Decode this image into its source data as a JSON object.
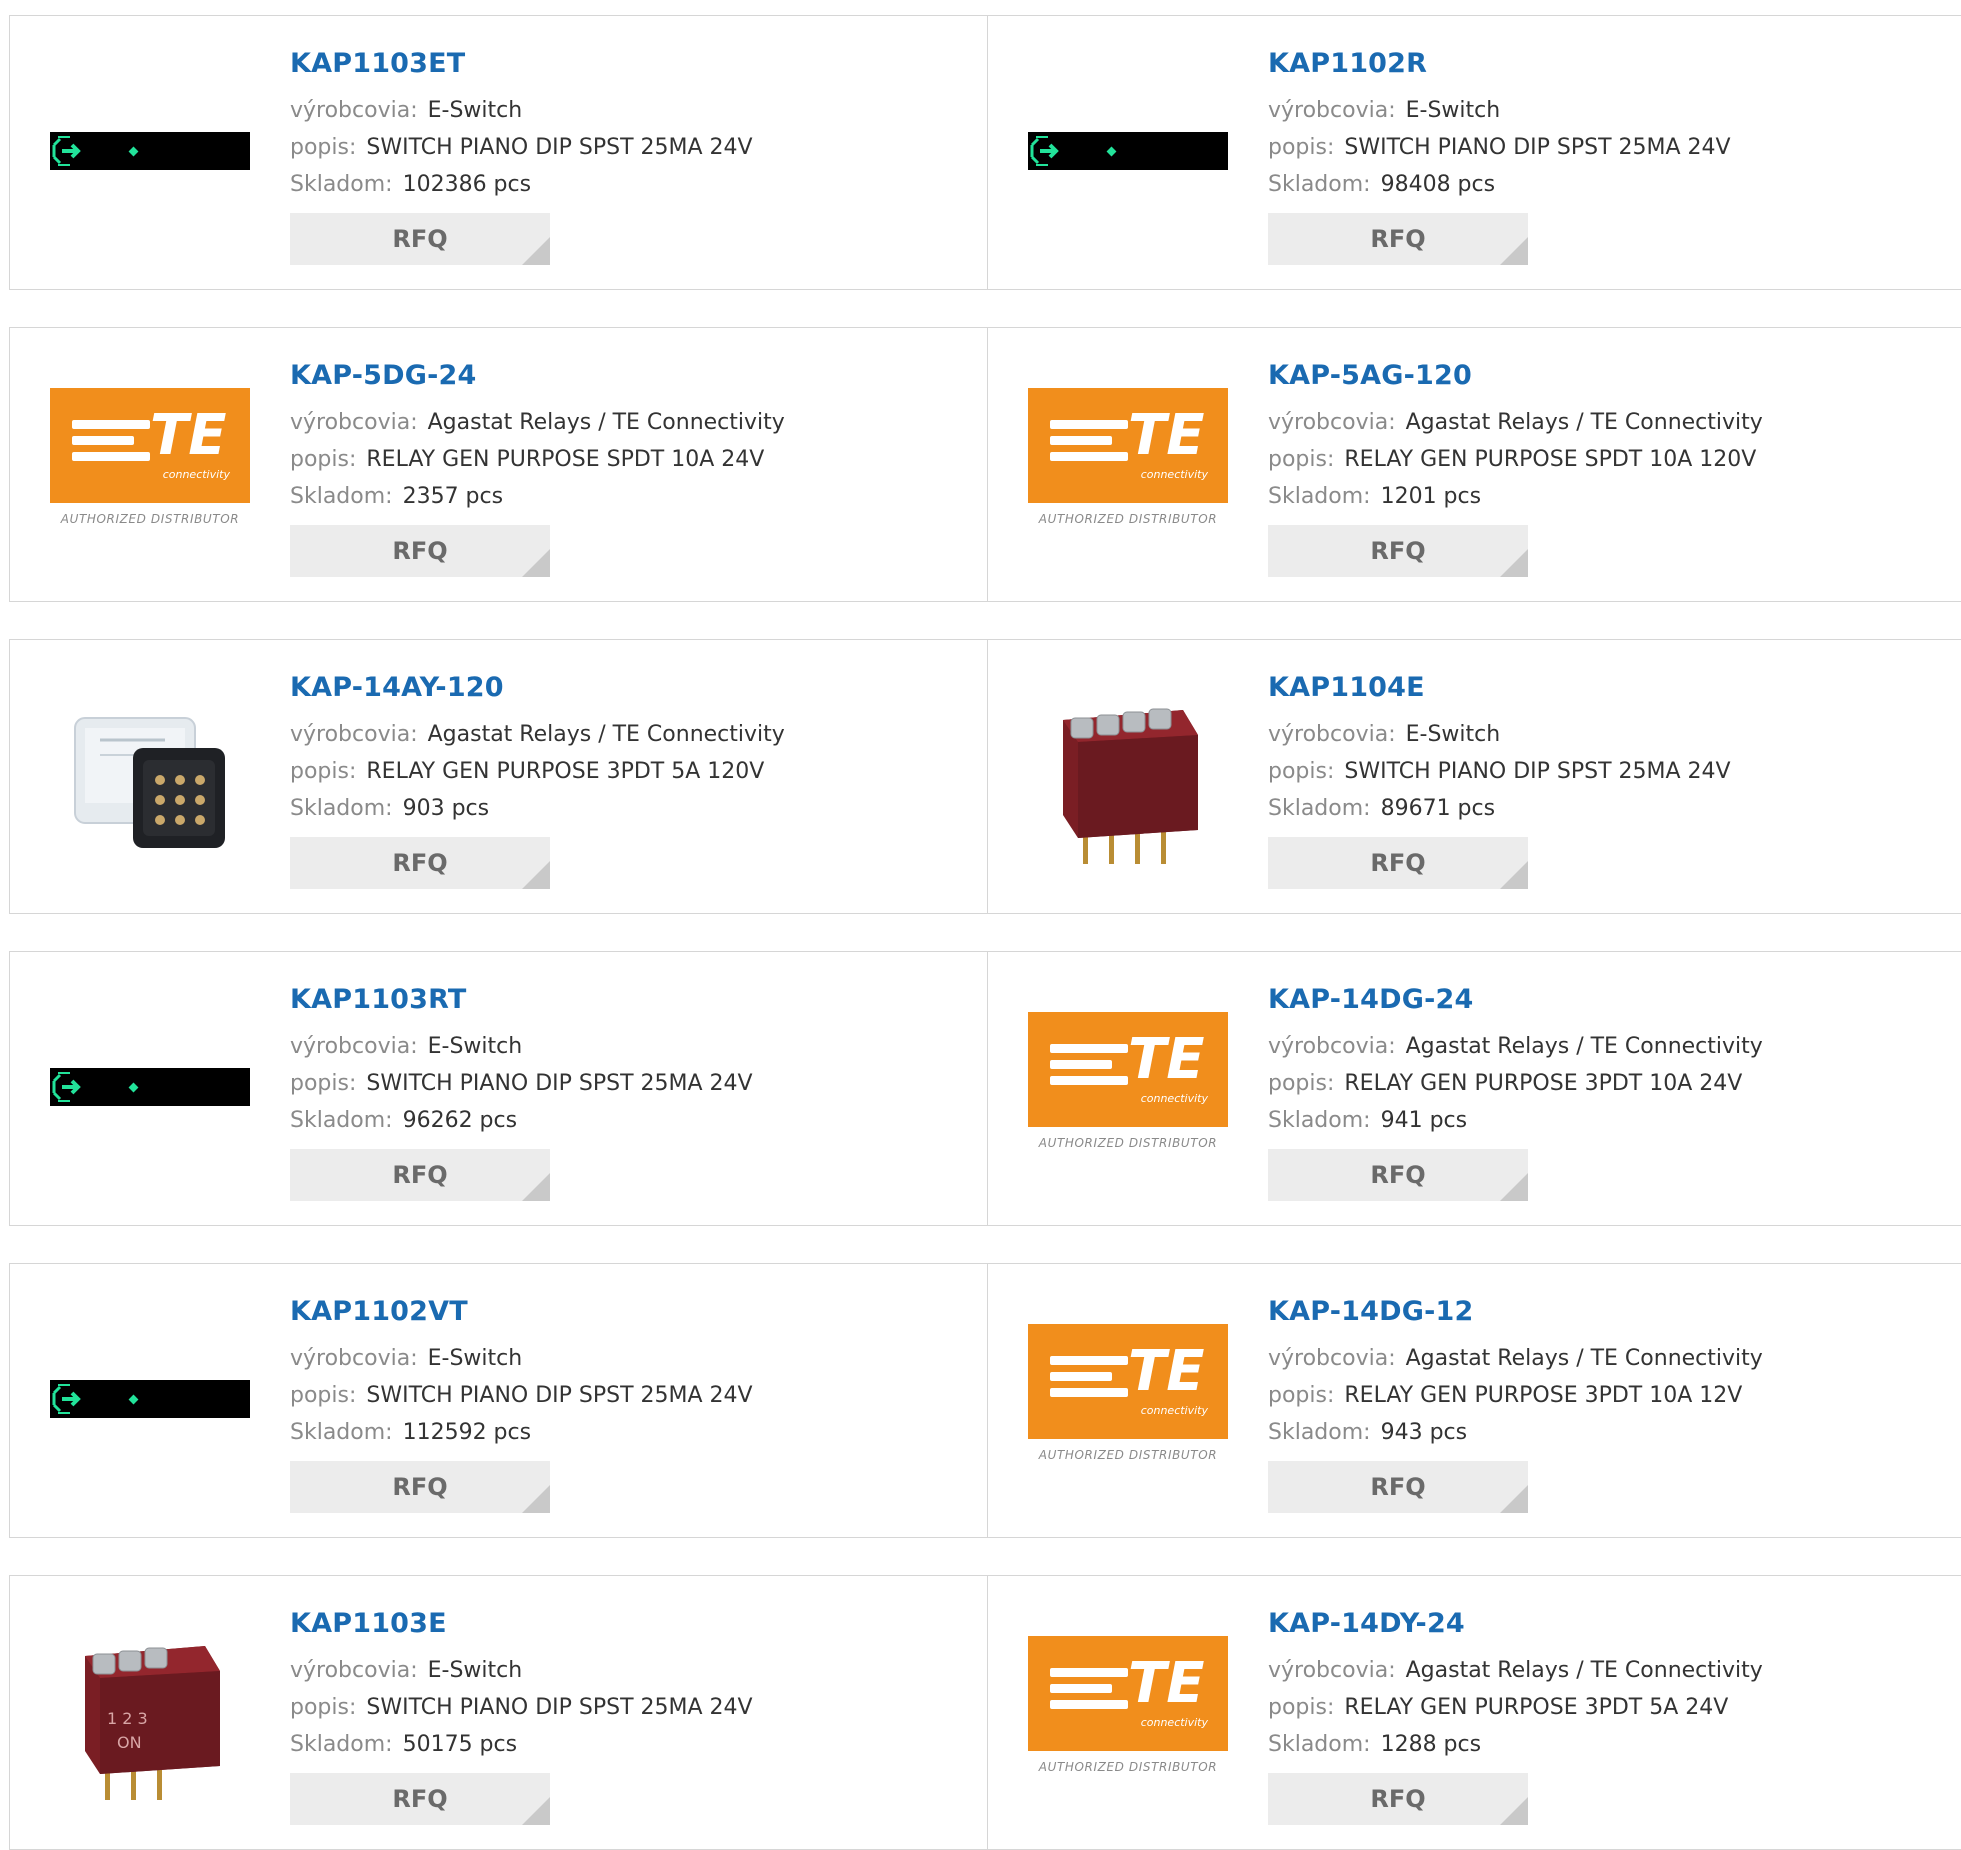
{
  "labels": {
    "manufacturer": "výrobcovia:",
    "description": "popis:",
    "stock": "Skladom:",
    "rfq": "RFQ"
  },
  "colors": {
    "link": "#1a6ab1",
    "label": "#8a8a8a",
    "button_bg": "#ececec",
    "te_orange": "#f18e1c",
    "led_green": "#22e39a"
  },
  "te_logo": {
    "letters": "TE",
    "sub": "connectivity",
    "authorized": "AUTHORIZED DISTRIBUTOR"
  },
  "products": [
    {
      "name": "KAP1103ET",
      "manufacturer": "E-Switch",
      "description": "SWITCH PIANO DIP SPST 25MA 24V",
      "stock": "102386 pcs",
      "image": "led-display"
    },
    {
      "name": "KAP1102R",
      "manufacturer": "E-Switch",
      "description": "SWITCH PIANO DIP SPST 25MA 24V",
      "stock": "98408 pcs",
      "image": "led-display"
    },
    {
      "name": "KAP-5DG-24",
      "manufacturer": "Agastat Relays / TE Connectivity",
      "description": "RELAY GEN PURPOSE SPDT 10A 24V",
      "stock": "2357 pcs",
      "image": "te-logo"
    },
    {
      "name": "KAP-5AG-120",
      "manufacturer": "Agastat Relays / TE Connectivity",
      "description": "RELAY GEN PURPOSE SPDT 10A 120V",
      "stock": "1201 pcs",
      "image": "te-logo"
    },
    {
      "name": "KAP-14AY-120",
      "manufacturer": "Agastat Relays / TE Connectivity",
      "description": "RELAY GEN PURPOSE 3PDT 5A 120V",
      "stock": "903 pcs",
      "image": "relay-photo"
    },
    {
      "name": "KAP1104E",
      "manufacturer": "E-Switch",
      "description": "SWITCH PIANO DIP SPST 25MA 24V",
      "stock": "89671 pcs",
      "image": "dip-switch-4"
    },
    {
      "name": "KAP1103RT",
      "manufacturer": "E-Switch",
      "description": "SWITCH PIANO DIP SPST 25MA 24V",
      "stock": "96262 pcs",
      "image": "led-display"
    },
    {
      "name": "KAP-14DG-24",
      "manufacturer": "Agastat Relays / TE Connectivity",
      "description": "RELAY GEN PURPOSE 3PDT 10A 24V",
      "stock": "941 pcs",
      "image": "te-logo"
    },
    {
      "name": "KAP1102VT",
      "manufacturer": "E-Switch",
      "description": "SWITCH PIANO DIP SPST 25MA 24V",
      "stock": "112592 pcs",
      "image": "led-display"
    },
    {
      "name": "KAP-14DG-12",
      "manufacturer": "Agastat Relays / TE Connectivity",
      "description": "RELAY GEN PURPOSE 3PDT 10A 12V",
      "stock": "943 pcs",
      "image": "te-logo"
    },
    {
      "name": "KAP1103E",
      "manufacturer": "E-Switch",
      "description": "SWITCH PIANO DIP SPST 25MA 24V",
      "stock": "50175 pcs",
      "image": "dip-switch-3",
      "switch_digits": "1 2 3",
      "switch_on": "ON"
    },
    {
      "name": "KAP-14DY-24",
      "manufacturer": "Agastat Relays / TE Connectivity",
      "description": "RELAY GEN PURPOSE 3PDT 5A 24V",
      "stock": "1288 pcs",
      "image": "te-logo"
    }
  ]
}
